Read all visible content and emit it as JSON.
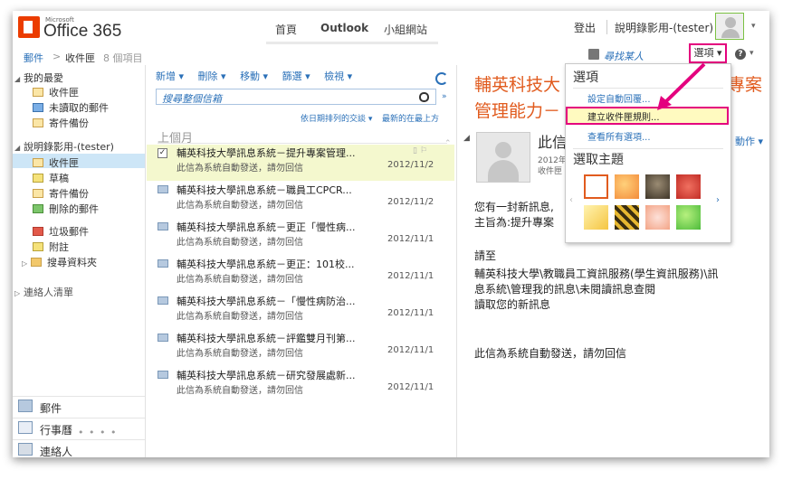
{
  "header": {
    "logo_small": "Microsoft",
    "logo_text": "Office 365",
    "nav": [
      "首頁",
      "Outlook",
      "小組網站"
    ],
    "signout": "登出",
    "username": "說明錄影用-(tester)"
  },
  "breadcrumb": {
    "mail": "郵件",
    "sep": ">",
    "folder": "收件匣",
    "count": "8 個項目",
    "find": "尋找某人",
    "options": "選項",
    "options_caret": "▾"
  },
  "sidebar": {
    "favorites_header": "我的最愛",
    "favorites": [
      "收件匣",
      "未讀取的郵件",
      "寄件備份"
    ],
    "account_header": "說明錄影用-(tester)",
    "folders": [
      "收件匣",
      "草稿",
      "寄件備份",
      "刪除的郵件",
      "垃圾郵件",
      "附註",
      "搜尋資料夾"
    ],
    "contacts_list": "連絡人清單",
    "dots": "• • • • •",
    "bottom": [
      "郵件",
      "行事曆",
      "連絡人"
    ]
  },
  "toolbar": {
    "items": [
      "新增 ▾",
      "刪除 ▾",
      "移動 ▾",
      "篩選 ▾",
      "檢視 ▾"
    ],
    "search_placeholder": "搜尋整個信箱",
    "sort_by": "依日期排列的交談 ▾",
    "sort_order": "最新的在最上方"
  },
  "message_list": {
    "group": "上個月",
    "messages": [
      {
        "subject": "輔英科技大學訊息系統－提升專案管理...",
        "preview": "此信為系統自動發送，請勿回信",
        "date": "2012/11/2"
      },
      {
        "subject": "輔英科技大學訊息系統－職員工CPCR...",
        "preview": "此信為系統自動發送，請勿回信",
        "date": "2012/11/2"
      },
      {
        "subject": "輔英科技大學訊息系統－更正「慢性病...",
        "preview": "此信為系統自動發送，請勿回信",
        "date": "2012/11/1"
      },
      {
        "subject": "輔英科技大學訊息系統－更正：101校...",
        "preview": "此信為系統自動發送，請勿回信",
        "date": "2012/11/1"
      },
      {
        "subject": "輔英科技大學訊息系統－「慢性病防治...",
        "preview": "此信為系統自動發送，請勿回信",
        "date": "2012/11/1"
      },
      {
        "subject": "輔英科技大學訊息系統－評鑑雙月刊第...",
        "preview": "此信為系統自動發送，請勿回信",
        "date": "2012/11/1"
      },
      {
        "subject": "輔英科技大學訊息系統－研究發展處新...",
        "preview": "此信為系統自動發送，請勿回信",
        "date": "2012/11/1"
      }
    ]
  },
  "reading_pane": {
    "title_line1": "輔英科技大",
    "title_line1_right": "專案",
    "title_line2": "管理能力－",
    "sender_name": "此信",
    "sender_date": "2012年",
    "sender_folder": "收件匣",
    "actions": "動作 ▾",
    "body": [
      "您有一封新訊息,",
      "主旨為:提升專案",
      "",
      "請至",
      "輔英科技大學\\教職員工資訊服務(學生資訊服務)\\訊",
      "息系統\\管理我的訊息\\未閱讀訊息查閱",
      "讀取您的新訊息",
      "",
      "此信為系統自動發送，請勿回信"
    ]
  },
  "options_menu": {
    "header": "選項",
    "items": [
      "設定自動回覆...",
      "建立收件匣規則...",
      "查看所有選項..."
    ],
    "theme_header": "選取主題",
    "themes": [
      "orange-frame",
      "orange-blob",
      "robot",
      "red-fruit",
      "yellow-gradient",
      "dark-stripe",
      "pink-sketch",
      "green-blob"
    ]
  },
  "colors": {
    "accent": "#e15b1e",
    "link": "#2a70b8",
    "highlight_border": "#e4007e",
    "selected_message": "#f4f8ce",
    "selected_folder": "#cde6f7"
  }
}
